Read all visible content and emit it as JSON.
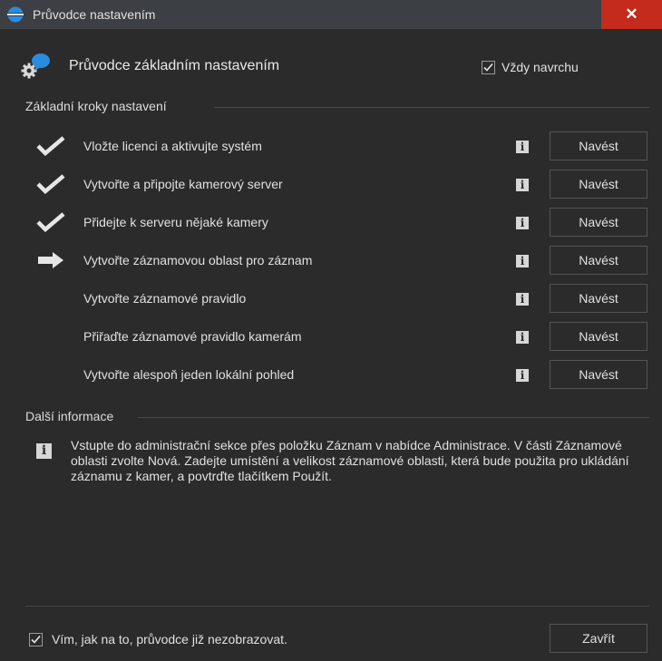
{
  "window": {
    "title": "Průvodce nastavením",
    "close_glyph": "✕"
  },
  "header": {
    "title": "Průvodce základním nastavením",
    "always_on_top_label": "Vždy navrchu",
    "always_on_top_checked": true
  },
  "steps_section": {
    "heading": "Základní kroky nastavení"
  },
  "steps": [
    {
      "label": "Vložte licenci a aktivujte systém",
      "status": "done",
      "button": "Navést"
    },
    {
      "label": "Vytvořte a připojte kamerový server",
      "status": "done",
      "button": "Navést"
    },
    {
      "label": "Přidejte k serveru nějaké kamery",
      "status": "done",
      "button": "Navést"
    },
    {
      "label": "Vytvořte záznamovou oblast pro záznam",
      "status": "current",
      "button": "Navést"
    },
    {
      "label": "Vytvořte záznamové pravidlo",
      "status": "pending",
      "button": "Navést"
    },
    {
      "label": "Přiřaďte záznamové pravidlo kamerám",
      "status": "pending",
      "button": "Navést"
    },
    {
      "label": "Vytvořte alespoň jeden lokální pohled",
      "status": "pending",
      "button": "Navést"
    }
  ],
  "info_section": {
    "heading": "Další informace",
    "text": "Vstupte do administrační sekce přes položku Záznam v nabídce Administrace. V části Záznamové oblasti zvolte Nová. Zadejte umístění a velikost záznamové oblasti, která bude použita pro ukládání záznamu z kamer, a povtrďte tlačítkem Použít."
  },
  "footer": {
    "dont_show_label": "Vím, jak na to, průvodce již nezobrazovat.",
    "dont_show_checked": true,
    "close_label": "Zavřít"
  },
  "colors": {
    "background": "#2b2b2b",
    "titlebar": "#3c3f44",
    "close": "#c42b1c",
    "accent_blue": "#2a8ce0"
  },
  "icons": {
    "done": "checkmark-icon",
    "current": "arrow-right-icon",
    "info": "info-icon"
  }
}
